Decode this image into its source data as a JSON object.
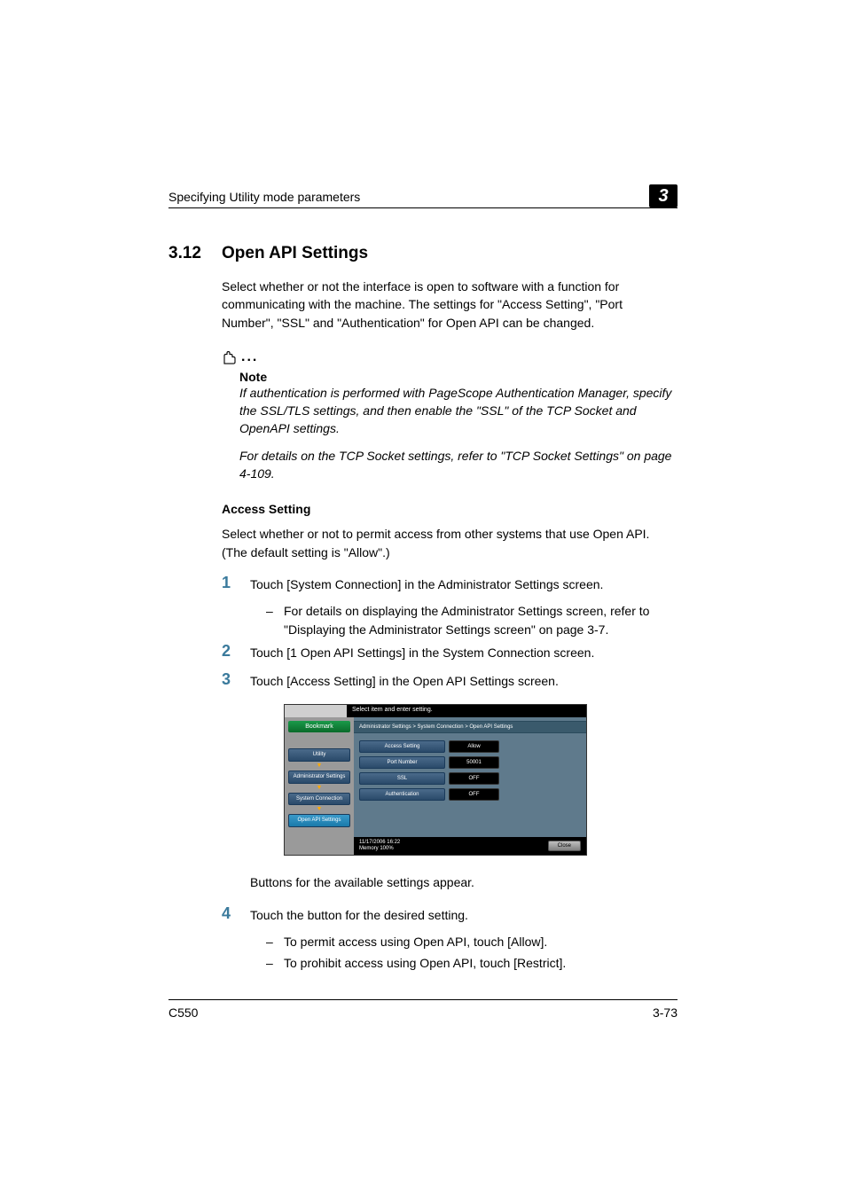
{
  "header": {
    "left": "Specifying Utility mode parameters",
    "chapter_badge": "3"
  },
  "section": {
    "number": "3.12",
    "title": "Open API Settings",
    "intro": "Select whether or not the interface is open to software with a function for communicating with the machine. The settings for \"Access Setting\", \"Port Number\", \"SSL\" and \"Authentication\" for Open API can be changed."
  },
  "note": {
    "label": "Note",
    "p1": "If authentication is performed with PageScope Authentication Manager, specify the SSL/TLS settings, and then enable the \"SSL\" of the TCP Socket and OpenAPI settings.",
    "p2": "For details on the TCP Socket settings, refer to \"TCP Socket Settings\" on page 4-109."
  },
  "access": {
    "heading": "Access Setting",
    "intro": "Select whether or not to permit access from other systems that use Open API. (The default setting is \"Allow\".)"
  },
  "steps": {
    "s1": {
      "n": "1",
      "text": "Touch [System Connection] in the Administrator Settings screen."
    },
    "s1_sub1": "For details on displaying the Administrator Settings screen, refer to \"Displaying the Administrator Settings screen\" on page 3-7.",
    "s2": {
      "n": "2",
      "text": "Touch [1 Open API Settings] in the System Connection screen."
    },
    "s3": {
      "n": "3",
      "text": "Touch [Access Setting] in the Open API Settings screen."
    },
    "s3_after": "Buttons for the available settings appear.",
    "s4": {
      "n": "4",
      "text": "Touch the button for the desired setting."
    },
    "s4_sub1": "To permit access using Open API, touch [Allow].",
    "s4_sub2": "To prohibit access using Open API, touch [Restrict]."
  },
  "ui": {
    "top_instruction": "Select item and enter setting.",
    "bookmark": "Bookmark",
    "nav": {
      "utility": "Utility",
      "admin": "Administrator Settings",
      "system": "System Connection",
      "openapi": "Open API Settings"
    },
    "breadcrumb": "Administrator Settings > System Connection > Open API Settings",
    "rows": {
      "access": {
        "label": "Access Setting",
        "value": "Allow"
      },
      "port": {
        "label": "Port Number",
        "value": "50001"
      },
      "ssl": {
        "label": "SSL",
        "value": "OFF"
      },
      "auth": {
        "label": "Authentication",
        "value": "OFF"
      }
    },
    "footer": {
      "datetime": "11/17/2006   16:22",
      "memory": "Memory        100%",
      "close": "Close"
    }
  },
  "footer": {
    "left": "C550",
    "right": "3-73"
  }
}
